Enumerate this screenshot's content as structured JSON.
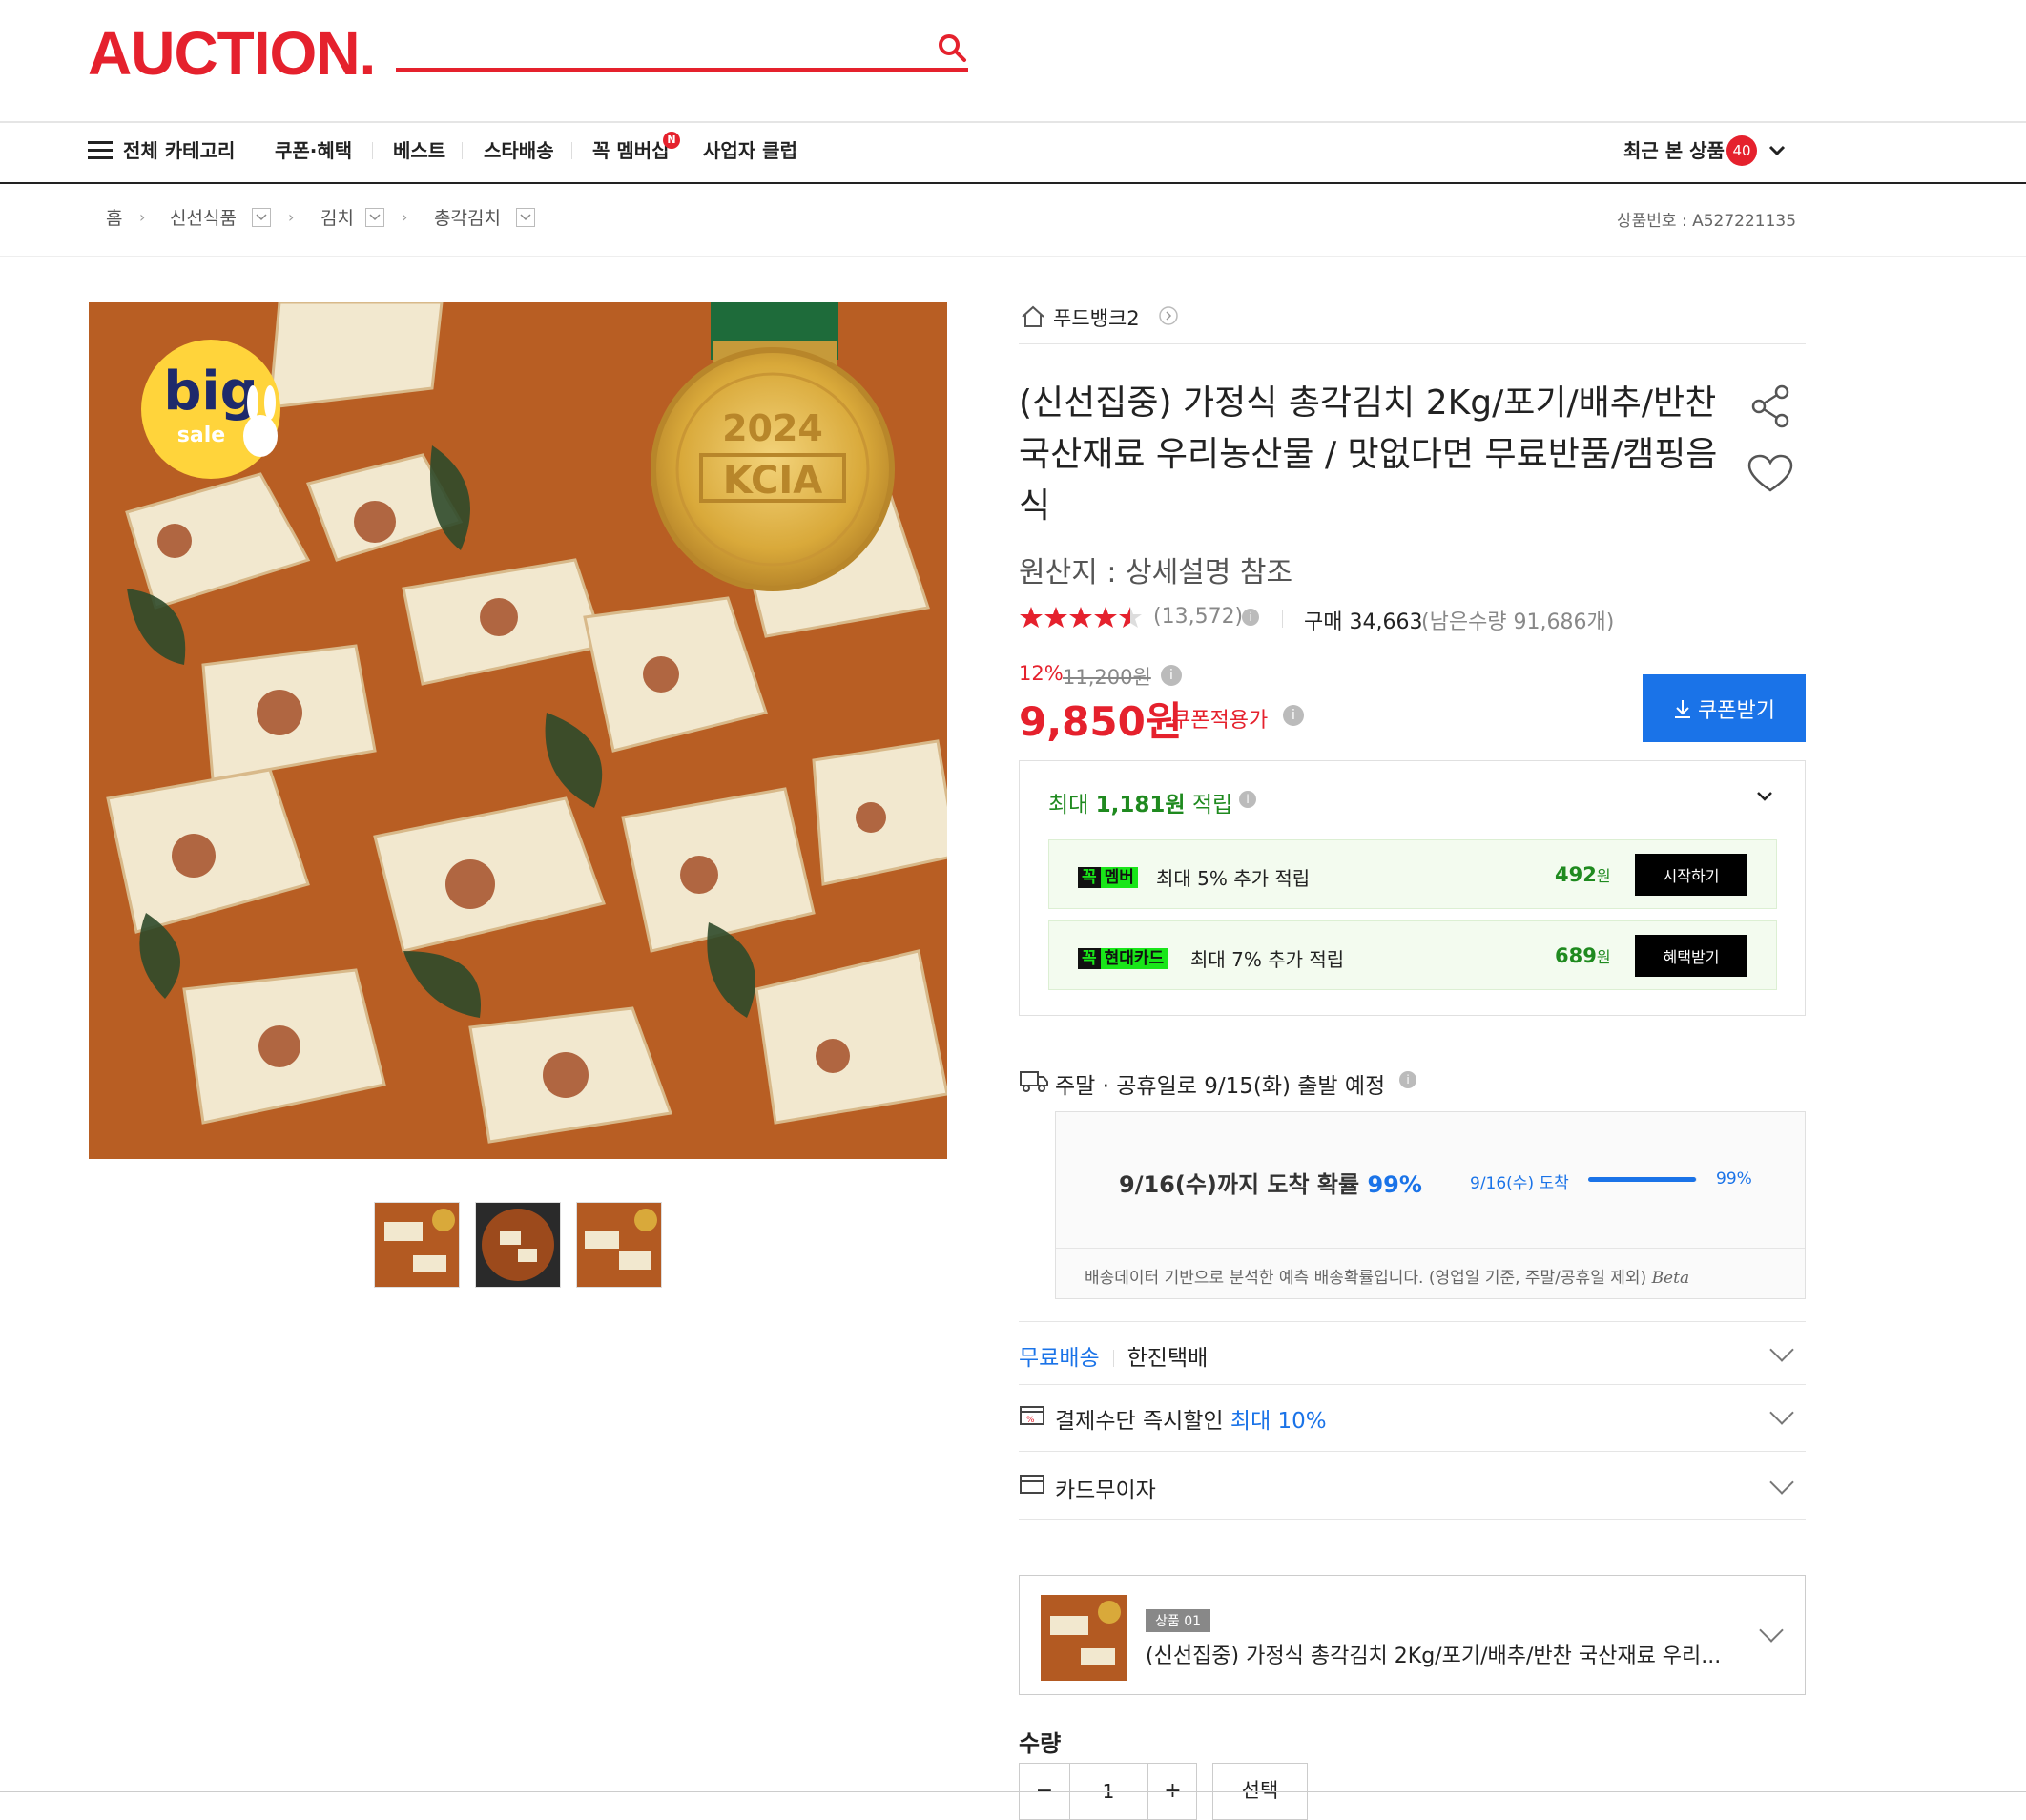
{
  "header": {
    "logo": "AUCTION."
  },
  "nav": {
    "all_categories": "전체 카테고리",
    "items": [
      "쿠폰·혜택",
      "베스트",
      "스타배송",
      "꼭 멤버십",
      "사업자 클럽"
    ],
    "new_badge": "N",
    "recent_label": "최근 본 상품",
    "recent_count": "40"
  },
  "breadcrumb": {
    "home": "홈",
    "items": [
      "신선식품",
      "김치",
      "총각김치"
    ],
    "product_no": "상품번호 : A527221135"
  },
  "product": {
    "badge_big": "big",
    "badge_sale": "sale",
    "medal_year": "2024",
    "medal_text": "KCIA",
    "seller": "푸드뱅크2",
    "title": "(신선집중) 가정식 총각김치 2Kg/포기/배추/반찬 국산재료 우리농산물 / 맛없다면 무료반품/캠핑음식",
    "origin": "원산지 : 상세설명 참조",
    "rating_stars": 4.5,
    "reviews": "(13,572)",
    "purchases": "구매 34,663",
    "remaining": "(남은수량 91,686개)",
    "discount_rate": "12%",
    "original_price": "11,200원",
    "price": "9,850원",
    "coupon_price_label": "쿠폰적용가",
    "coupon_button": "쿠폰받기"
  },
  "points": {
    "title_prefix": "최대",
    "title_amount": "1,181원",
    "title_suffix": "적립",
    "rows": [
      {
        "tag1": "꼭",
        "tag2": "멤버",
        "desc": "최대 5% 추가 적립",
        "amount": "492",
        "unit": "원",
        "button": "시작하기"
      },
      {
        "tag1": "꼭",
        "tag2": "현대카드",
        "desc": "최대 7% 추가 적립",
        "amount": "689",
        "unit": "원",
        "button": "혜택받기"
      }
    ]
  },
  "shipping": {
    "departure": "주말 · 공휴일로 9/15(화) 출발 예정",
    "prob_title": "9/16(수)까지 도착 확률",
    "prob_value": "99%",
    "bar_label": "9/16(수) 도착",
    "bar_value": "99%",
    "bar_fraction": 0.99,
    "note": "배송데이터 기반으로 분석한 예측 배송확률입니다. (영업일 기준, 주말/공휴일 제외)",
    "beta": "Beta"
  },
  "accordion": {
    "free_ship": "무료배송",
    "carrier": "한진택배",
    "payment_label": "결제수단 즉시할인",
    "payment_highlight": "최대 10%",
    "installment": "카드무이자"
  },
  "option": {
    "tag": "상품 01",
    "title": "(신선집중) 가정식 총각김치 2Kg/포기/배추/반찬 국산재료 우리..."
  },
  "quantity": {
    "label": "수량",
    "value": "1",
    "minus": "−",
    "plus": "+",
    "select": "선택"
  },
  "colors": {
    "brand_red": "#e5212d",
    "price_red": "#e5212d",
    "blue": "#1a73e8",
    "green": "#19e619"
  }
}
